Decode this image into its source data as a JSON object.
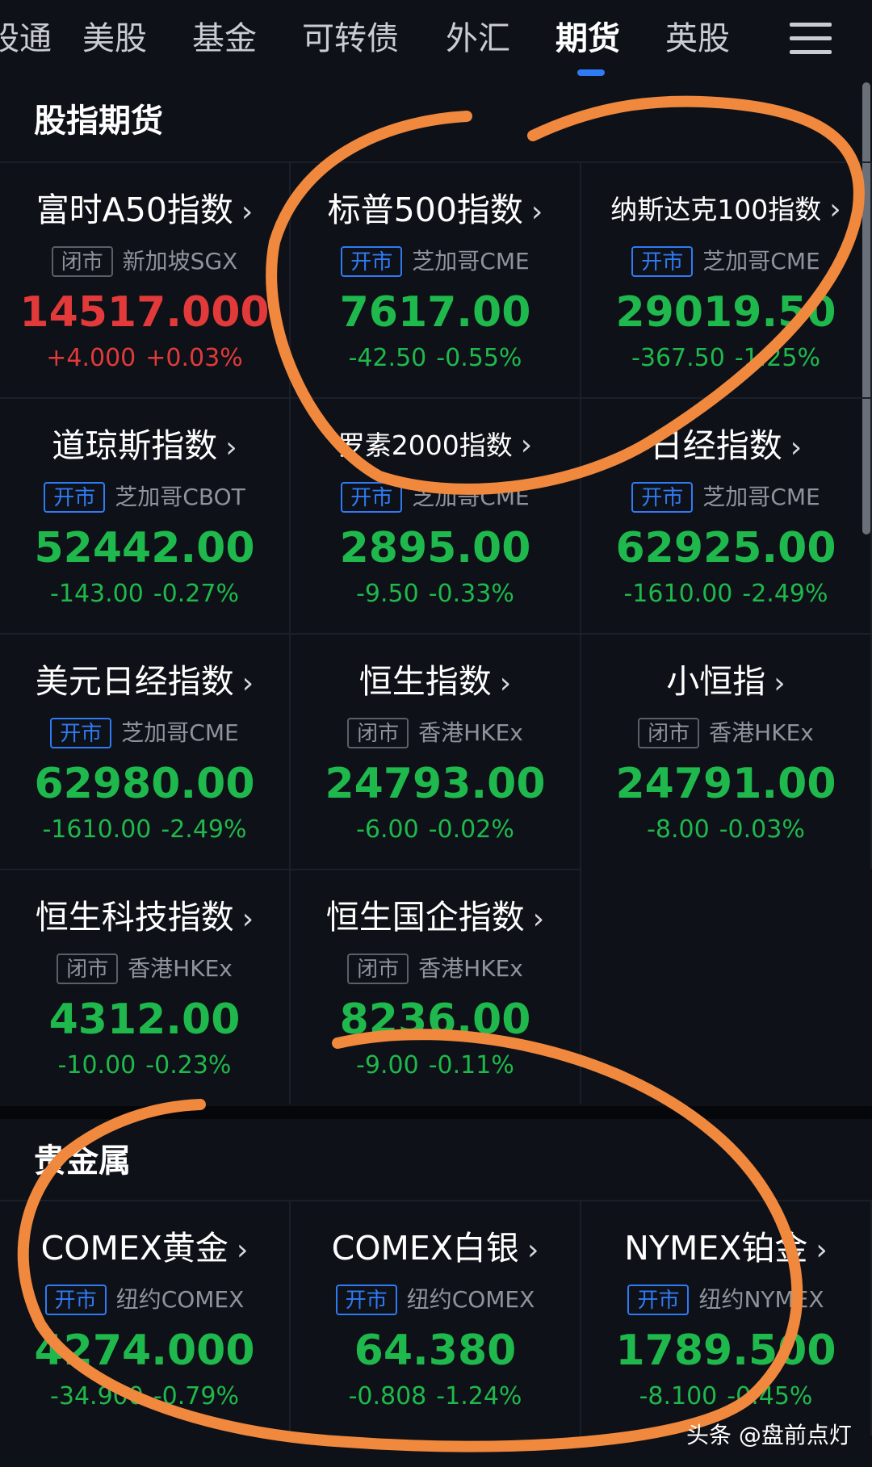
{
  "tabs": [
    {
      "label": "股通"
    },
    {
      "label": "美股"
    },
    {
      "label": "基金"
    },
    {
      "label": "可转债"
    },
    {
      "label": "外汇"
    },
    {
      "label": "期货",
      "active": true
    },
    {
      "label": "英股"
    }
  ],
  "sections": [
    {
      "title": "股指期货",
      "items": [
        {
          "name": "富时A50指数",
          "status": "闭市",
          "exchange": "新加坡SGX",
          "price": "14517.000",
          "change": "+4.000",
          "change_pct": "+0.03%",
          "direction": "up"
        },
        {
          "name": "标普500指数",
          "status": "开市",
          "exchange": "芝加哥CME",
          "price": "7617.00",
          "change": "-42.50",
          "change_pct": "-0.55%",
          "direction": "down"
        },
        {
          "name": "纳斯达克100指数",
          "status": "开市",
          "exchange": "芝加哥CME",
          "price": "29019.50",
          "change": "-367.50",
          "change_pct": "-1.25%",
          "direction": "down"
        },
        {
          "name": "道琼斯指数",
          "status": "开市",
          "exchange": "芝加哥CBOT",
          "price": "52442.00",
          "change": "-143.00",
          "change_pct": "-0.27%",
          "direction": "down"
        },
        {
          "name": "罗素2000指数",
          "status": "开市",
          "exchange": "芝加哥CME",
          "price": "2895.00",
          "change": "-9.50",
          "change_pct": "-0.33%",
          "direction": "down"
        },
        {
          "name": "日经指数",
          "status": "开市",
          "exchange": "芝加哥CME",
          "price": "62925.00",
          "change": "-1610.00",
          "change_pct": "-2.49%",
          "direction": "down"
        },
        {
          "name": "美元日经指数",
          "status": "开市",
          "exchange": "芝加哥CME",
          "price": "62980.00",
          "change": "-1610.00",
          "change_pct": "-2.49%",
          "direction": "down"
        },
        {
          "name": "恒生指数",
          "status": "闭市",
          "exchange": "香港HKEx",
          "price": "24793.00",
          "change": "-6.00",
          "change_pct": "-0.02%",
          "direction": "down"
        },
        {
          "name": "小恒指",
          "status": "闭市",
          "exchange": "香港HKEx",
          "price": "24791.00",
          "change": "-8.00",
          "change_pct": "-0.03%",
          "direction": "down"
        },
        {
          "name": "恒生科技指数",
          "status": "闭市",
          "exchange": "香港HKEx",
          "price": "4312.00",
          "change": "-10.00",
          "change_pct": "-0.23%",
          "direction": "down"
        },
        {
          "name": "恒生国企指数",
          "status": "闭市",
          "exchange": "香港HKEx",
          "price": "8236.00",
          "change": "-9.00",
          "change_pct": "-0.11%",
          "direction": "down"
        }
      ]
    },
    {
      "title": "贵金属",
      "items": [
        {
          "name": "COMEX黄金",
          "status": "开市",
          "exchange": "纽约COMEX",
          "price": "4274.000",
          "change": "-34.900",
          "change_pct": "-0.79%",
          "direction": "down"
        },
        {
          "name": "COMEX白银",
          "status": "开市",
          "exchange": "纽约COMEX",
          "price": "64.380",
          "change": "-0.808",
          "change_pct": "-1.24%",
          "direction": "down"
        },
        {
          "name": "NYMEX铂金",
          "status": "开市",
          "exchange": "纽约NYMEX",
          "price": "1789.500",
          "change": "-8.100",
          "change_pct": "-0.45%",
          "direction": "down"
        }
      ]
    }
  ],
  "colors": {
    "up": "#e23a3a",
    "down": "#1fb84c",
    "accent": "#2f7bf5",
    "annotation": "#f0883e"
  },
  "watermark": "头条 @盘前点灯"
}
